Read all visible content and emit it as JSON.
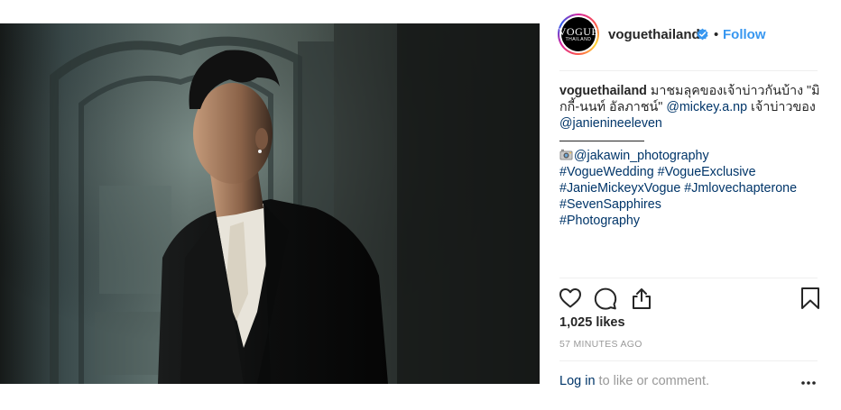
{
  "post": {
    "username": "voguethailand",
    "follow_label": "Follow",
    "separator_dot": "•",
    "avatar": {
      "logo_text": "VOGUE",
      "logo_sub": "THAILAND"
    },
    "caption": {
      "author": "voguethailand",
      "line1_text": " มาชมลุคของเจ้าบ่าวกันบ้าง \"มิ",
      "line2_text": "กกี้-นนท์ อัลภาชน์\" ",
      "line2_mention": "@mickey.a.np",
      "line2_tail": " เจ้าบ่าวของ",
      "line3_mention": "@janienineeleven",
      "line4_mention": "@jakawin_photography",
      "hashtags_line1": "#VogueWedding #VogueExclusive",
      "hashtags_line2": "#JanieMickeyxVogue #Jmlovechapterone",
      "hashtags_line3": "#SevenSapphires",
      "hashtags_line4": "#Photography"
    },
    "likes_text": "1,025 likes",
    "time_text": "57 MINUTES AGO",
    "login": {
      "link_label": "Log in",
      "tail_text": " to like or comment."
    }
  },
  "colors": {
    "link_blue": "#3897f0",
    "mention_navy": "#003569",
    "muted_gray": "#999999",
    "verified_blue": "#3897f0"
  },
  "icons": {
    "like": "heart-icon",
    "comment": "comment-icon",
    "share": "share-icon",
    "save": "bookmark-icon",
    "more": "more-options-icon",
    "verified": "verified-badge-icon"
  }
}
